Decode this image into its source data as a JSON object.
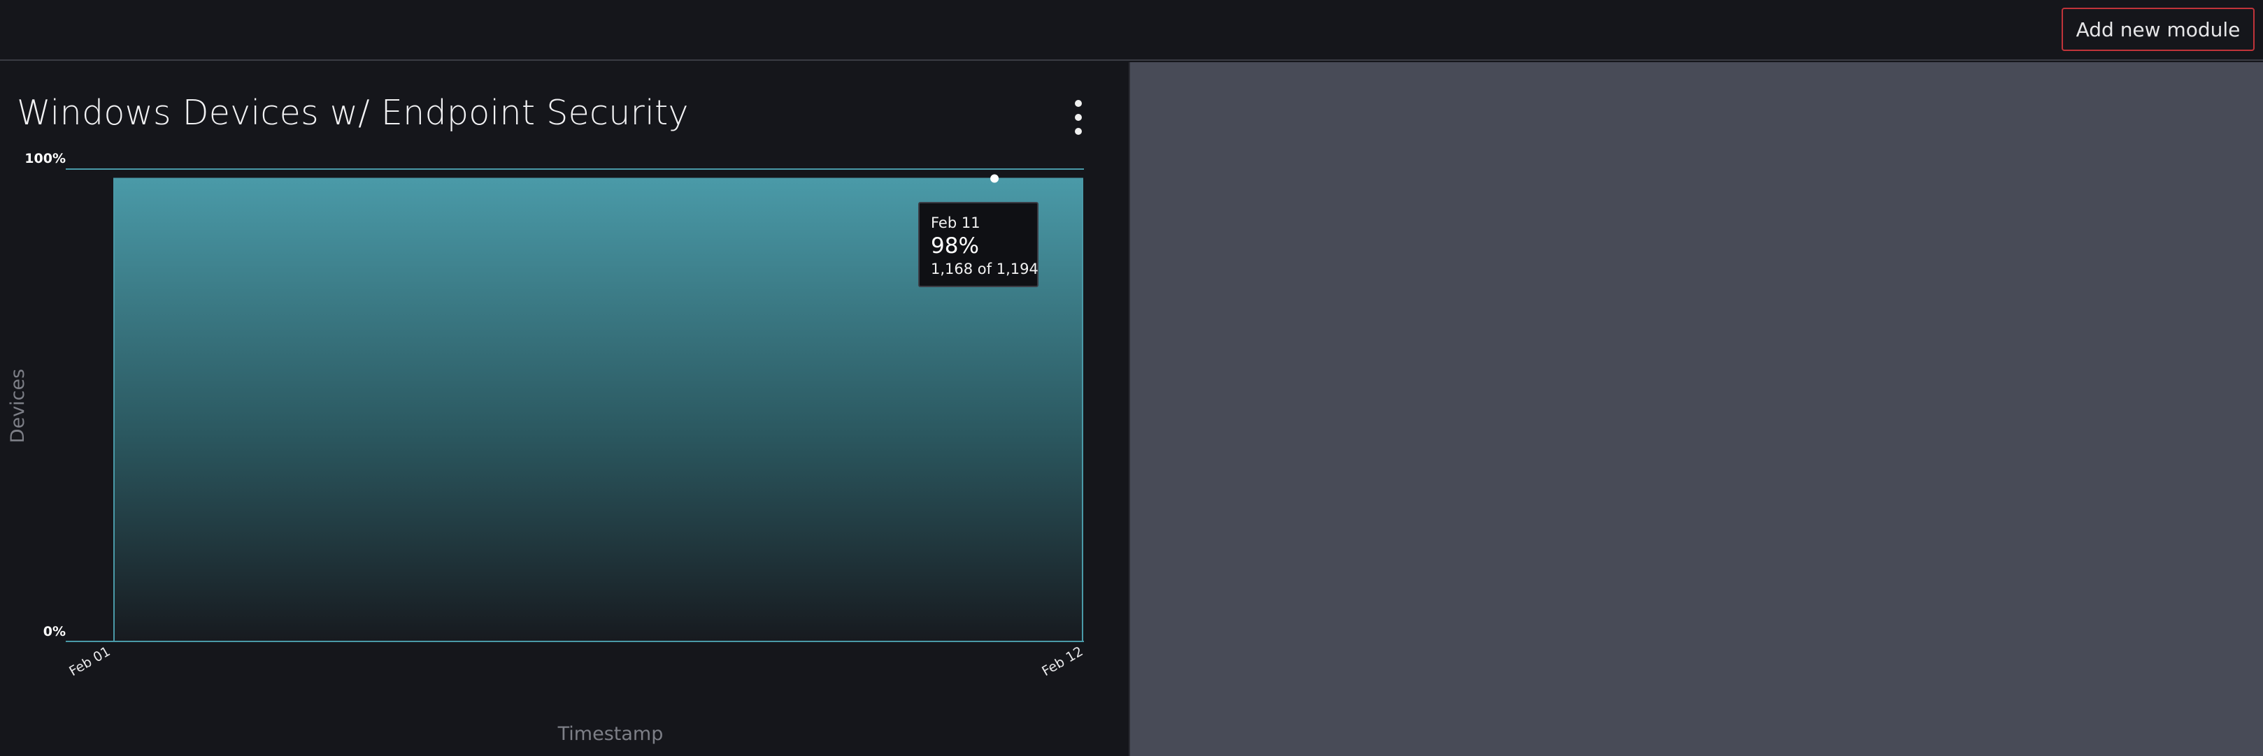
{
  "topbar": {
    "add_module_label": "Add new module"
  },
  "module": {
    "title": "Windows Devices w/ Endpoint Security",
    "menu_icon": "kebab-vertical-icon"
  },
  "tooltip": {
    "date": "Feb 11",
    "value": "98%",
    "detail": "1,168 of 1,194"
  },
  "colors": {
    "accent": "#4a9aa8",
    "add_button_border": "#c0343a",
    "right_pane": "#484b57",
    "background": "#15161b"
  },
  "chart_data": {
    "type": "area",
    "x": [
      "Feb 01",
      "Feb 12"
    ],
    "y": [
      98,
      98
    ],
    "xlabel": "Timestamp",
    "ylabel": "Devices",
    "ylim": [
      0,
      100
    ],
    "y_ticks": [
      "0%",
      "100%"
    ],
    "x_ticks": [
      "Feb 01",
      "Feb 12"
    ],
    "highlight": {
      "x": "Feb 11",
      "y": 98,
      "numerator": 1168,
      "denominator": 1194
    },
    "grid": false,
    "legend": "none"
  }
}
